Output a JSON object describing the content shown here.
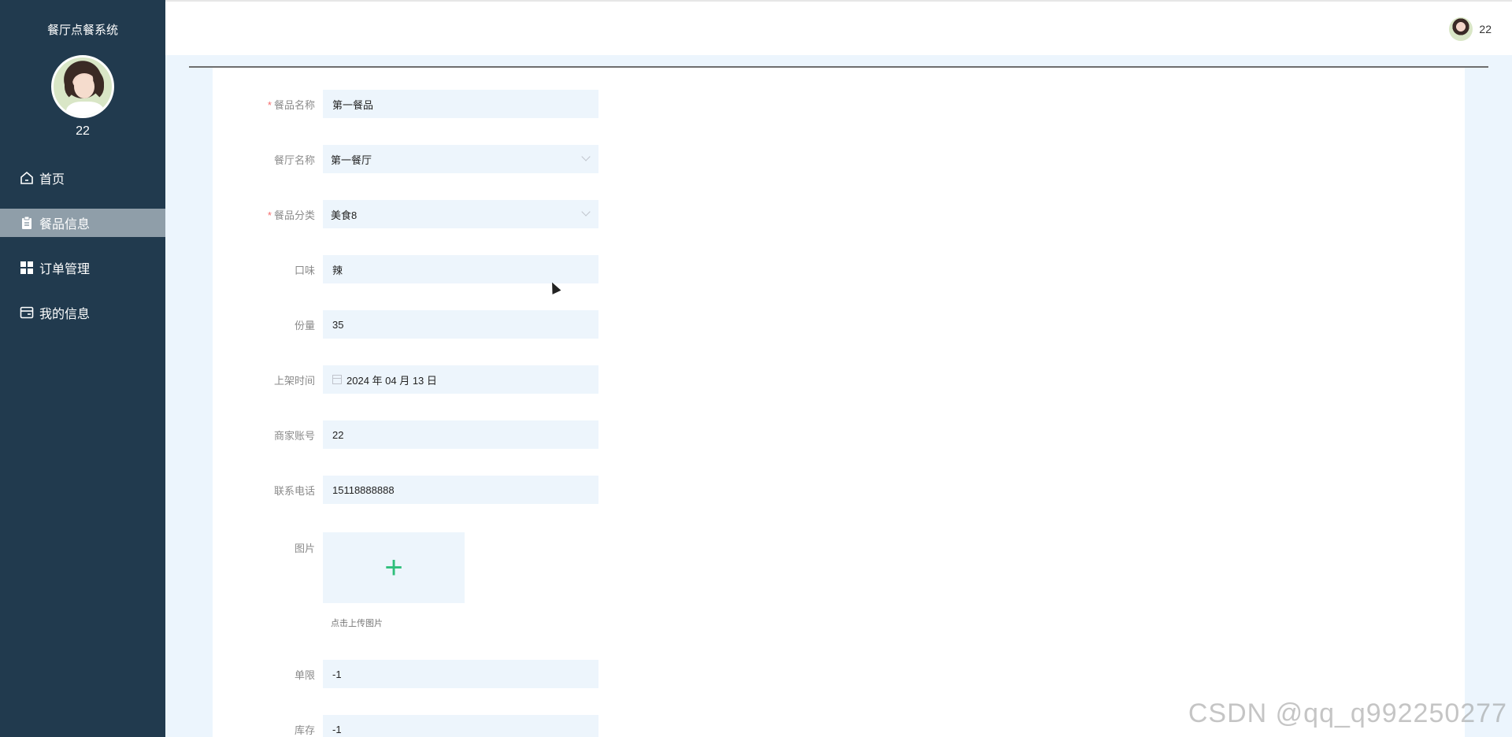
{
  "sidebar": {
    "system_title": "餐厅点餐系统",
    "username": "22",
    "menu": [
      {
        "label": "首页",
        "icon": "home-icon"
      },
      {
        "label": "餐品信息",
        "icon": "clipboard-icon",
        "active": true
      },
      {
        "label": "订单管理",
        "icon": "grid-icon"
      },
      {
        "label": "我的信息",
        "icon": "card-icon"
      }
    ]
  },
  "header": {
    "username": "22"
  },
  "form": {
    "dish_name": {
      "label": "餐品名称",
      "value": "第一餐品",
      "required": true
    },
    "restaurant_name": {
      "label": "餐厅名称",
      "value": "第一餐厅"
    },
    "dish_category": {
      "label": "餐品分类",
      "value": "美食8",
      "required": true
    },
    "taste": {
      "label": "口味",
      "value": "辣"
    },
    "portion": {
      "label": "份量",
      "value": "35"
    },
    "listing_date": {
      "label": "上架时间",
      "value": "2024 年 04 月 13 日"
    },
    "merchant_account": {
      "label": "商家账号",
      "value": "22"
    },
    "phone": {
      "label": "联系电话",
      "value": "15118888888"
    },
    "image": {
      "label": "图片",
      "tip": "点击上传图片"
    },
    "limit": {
      "label": "单限",
      "value": "-1"
    },
    "stock": {
      "label": "库存",
      "value": "-1"
    }
  },
  "watermark": "CSDN @qq_q992250277",
  "colors": {
    "sidebar_bg": "#213a4e",
    "active_menu_bg": "#8f9ea9",
    "input_bg": "#edf5fc",
    "page_bg": "#ecf5fd",
    "upload_plus": "#2fbf7b",
    "required_star": "#f56c6c"
  }
}
